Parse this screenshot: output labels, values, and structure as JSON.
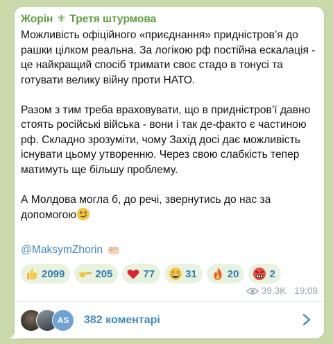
{
  "post": {
    "author": "Жорін",
    "separator": "⚜",
    "channel": "Третя штурмова",
    "paragraphs": [
      "Можливість офіційного «приєднання» придністров’я до рашки цілком реальна. За логікою рф постійна ескалація - це найкращий спосіб тримати своє стадо в тонусі та готувати велику війну проти НАТО.",
      "Разом з тим треба враховувати, що в придністров’ї давно стоять російські війська - вони і так де-факто є частиною рф. Складно зрозуміти, чому Захід досі дає можливість існувати цьому утворенню. Через свою слабкість тепер матимуть ще більшу проблему."
    ],
    "last_paragraph": "А Молдова могла б, до речі, звернутись до нас за допомогою",
    "mention": "@MaksymZhorin",
    "views": "39.3K",
    "time": "19:08"
  },
  "reactions": [
    {
      "icon": "thumbs-up",
      "count": "2099"
    },
    {
      "icon": "pointing-hand",
      "count": "205"
    },
    {
      "icon": "red-heart",
      "count": "77"
    },
    {
      "icon": "grinning-face",
      "count": "31"
    },
    {
      "icon": "fire",
      "count": "20"
    },
    {
      "icon": "angry-face",
      "count": "2"
    }
  ],
  "comments": {
    "label": "382 коментарі",
    "avatar_initials": "AS"
  },
  "colors": {
    "background": "#c9d9a9",
    "author": "#5aa03d",
    "link": "#3e88c4",
    "reaction_bg": "#e8f3df"
  }
}
